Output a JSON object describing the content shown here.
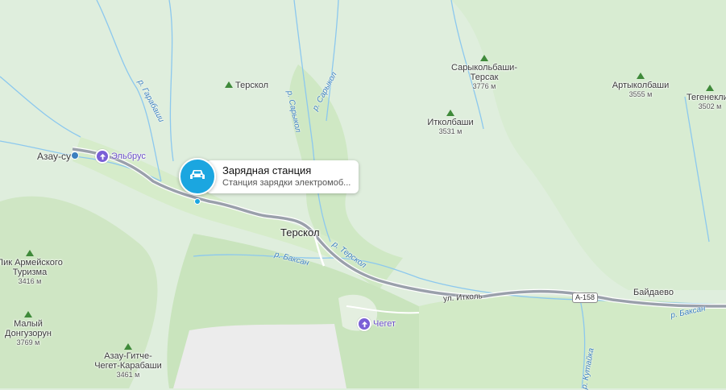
{
  "map": {
    "colors": {
      "land": "#dfeedd",
      "forest": "#c6e2b9",
      "valley": "#d4ebc9",
      "rock": "#ececec",
      "river": "#8cc8ee",
      "road": "#9aa0ab",
      "accent": "#1ba6e0"
    }
  },
  "card": {
    "title": "Зарядная станция",
    "subtitle": "Станция зарядки электромоб...",
    "icon": "car-icon"
  },
  "places": {
    "terskol_top": "Терскол",
    "terskol_town": "Терскол",
    "azau": "Азау-су",
    "elbrus": "Эльбрус",
    "cheget": "Чегет",
    "baydaevo": "Байдаево"
  },
  "peaks": [
    {
      "name": "Сарыкольбаши-Терсак",
      "line1": "Сарыкольбаши-",
      "line2": "Терсак",
      "elev": "3776 м"
    },
    {
      "name": "Артыколбаши",
      "line1": "Артыколбаши",
      "line2": "",
      "elev": "3555 м"
    },
    {
      "name": "Тегенеклиб",
      "line1": "Тегенеклиб",
      "line2": "",
      "elev": "3502 м"
    },
    {
      "name": "Итколбаши",
      "line1": "Итколбаши",
      "line2": "",
      "elev": "3531 м"
    },
    {
      "name": "Пик Армейского Туризма",
      "line1": "Пик Армейского",
      "line2": "Туризма",
      "elev": "3416 м"
    },
    {
      "name": "Малый Донгузорун",
      "line1": "Малый",
      "line2": "Донгузорун",
      "elev": "3769 м"
    },
    {
      "name": "Азау-Гитче-Чегет-Карабаши",
      "line1": "Азау-Гитче-",
      "line2": "Чегет-Карабаши",
      "elev": "3461 м"
    }
  ],
  "rivers": {
    "garabashi": "р. Гарабаши",
    "sarykol": "р. Сарыкол",
    "terskol": "р. Терскол",
    "baksan_w": "р. Баксан",
    "baksan_e": "р. Баксан",
    "kutayka": "р. Кутайка"
  },
  "roads": {
    "street": "ул. Итколь",
    "shield": "А-158"
  }
}
